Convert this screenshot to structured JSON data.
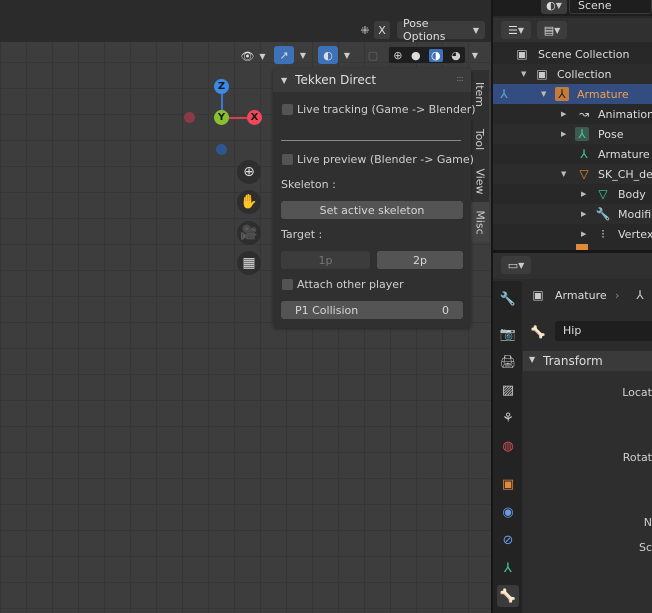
{
  "viewport": {
    "header": {
      "x_label": "X",
      "pose_options": "Pose Options"
    }
  },
  "side_tabs": [
    {
      "label": "Item"
    },
    {
      "label": "Tool"
    },
    {
      "label": "View"
    },
    {
      "label": "Misc"
    }
  ],
  "panel": {
    "title": "Tekken Direct",
    "live_tracking": "Live tracking (Game -> Blender)",
    "live_preview": "Live preview (Blender -> Game)",
    "skeleton_label": "Skeleton :",
    "set_skeleton": "Set active skeleton",
    "target_label": "Target :",
    "target_1p": "1p",
    "target_2p": "2p",
    "attach_other": "Attach other player",
    "p1_collision_label": "P1 Collision",
    "p1_collision_value": "0"
  },
  "gizmo": {
    "z": "Z",
    "y": "Y",
    "x": "X"
  },
  "outliner": {
    "scene_label": "Scene",
    "rows": [
      {
        "label": "Scene Collection"
      },
      {
        "label": "Collection"
      },
      {
        "label": "Armature"
      },
      {
        "label": "Animation"
      },
      {
        "label": "Pose"
      },
      {
        "label": "Armature"
      },
      {
        "label": "SK_CH_dek"
      },
      {
        "label": "Body"
      },
      {
        "label": "Modifie"
      },
      {
        "label": "Vertex"
      }
    ]
  },
  "properties": {
    "breadcrumb_object": "Armature",
    "bone_name": "Hip",
    "transform_label": "Transform",
    "fields": [
      "Locat",
      "Rotat",
      "N",
      "Sc"
    ]
  }
}
